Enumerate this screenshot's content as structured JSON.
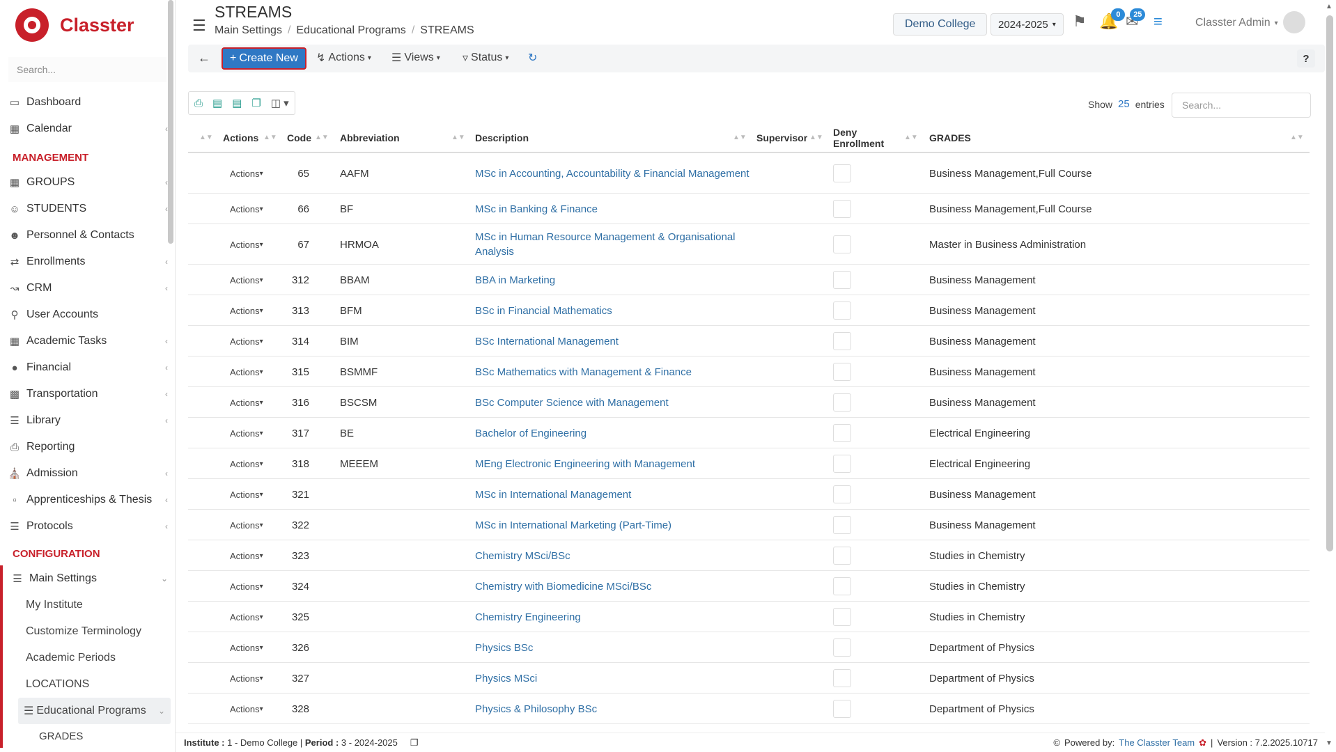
{
  "brand": "Classter",
  "sidebar": {
    "search_placeholder": "Search...",
    "top_items": [
      {
        "label": "Dashboard",
        "icon": "laptop-icon"
      },
      {
        "label": "Calendar",
        "icon": "calendar-icon"
      }
    ],
    "management_title": "MANAGEMENT",
    "management_items": [
      {
        "label": "GROUPS"
      },
      {
        "label": "STUDENTS"
      },
      {
        "label": "Personnel & Contacts"
      },
      {
        "label": "Enrollments"
      },
      {
        "label": "CRM"
      },
      {
        "label": "User Accounts"
      },
      {
        "label": "Academic Tasks"
      },
      {
        "label": "Financial"
      },
      {
        "label": "Transportation"
      },
      {
        "label": "Library"
      },
      {
        "label": "Reporting"
      },
      {
        "label": "Admission"
      },
      {
        "label": "Apprenticeships & Thesis"
      },
      {
        "label": "Protocols"
      }
    ],
    "configuration_title": "CONFIGURATION",
    "main_settings": "Main Settings",
    "sub_items": [
      "My Institute",
      "Customize Terminology",
      "Academic Periods",
      "LOCATIONS"
    ],
    "educational_programs": "Educational Programs",
    "grades": "GRADES"
  },
  "header": {
    "title": "STREAMS",
    "breadcrumb": [
      "Main Settings",
      "Educational Programs",
      "STREAMS"
    ],
    "college": "Demo College",
    "year": "2024-2025",
    "notifications_count": "0",
    "messages_count": "25",
    "user": "Classter Admin"
  },
  "toolbar": {
    "create_new": "Create New",
    "actions": "Actions",
    "views": "Views",
    "status": "Status",
    "help": "?"
  },
  "table_controls": {
    "show_label": "Show",
    "entries_count": "25",
    "entries_label": "entries",
    "search_placeholder": "Search..."
  },
  "table": {
    "columns": [
      "Actions",
      "Code",
      "Abbreviation",
      "Description",
      "Supervisor",
      "Deny Enrollment",
      "GRADES"
    ],
    "row_action_label": "Actions",
    "rows": [
      {
        "code": "65",
        "abbr": "AAFM",
        "desc": "MSc in Accounting, Accountability & Financial Management",
        "grades": "Business Management,Full Course"
      },
      {
        "code": "66",
        "abbr": "BF",
        "desc": "MSc in Banking & Finance",
        "grades": "Business Management,Full Course"
      },
      {
        "code": "67",
        "abbr": "HRMOA",
        "desc": "MSc in Human Resource Management & Organisational Analysis",
        "grades": "Master in Business Administration"
      },
      {
        "code": "312",
        "abbr": "BBAM",
        "desc": "BBA in Marketing",
        "grades": "Business Management"
      },
      {
        "code": "313",
        "abbr": "BFM",
        "desc": "BSc in Financial Mathematics",
        "grades": "Business Management"
      },
      {
        "code": "314",
        "abbr": "BIM",
        "desc": "BSc International Management",
        "grades": "Business Management"
      },
      {
        "code": "315",
        "abbr": "BSMMF",
        "desc": "BSc Mathematics with Management & Finance",
        "grades": "Business Management"
      },
      {
        "code": "316",
        "abbr": "BSCSM",
        "desc": "BSc Computer Science with Management",
        "grades": "Business Management"
      },
      {
        "code": "317",
        "abbr": "BE",
        "desc": "Bachelor of Engineering",
        "grades": "Electrical Engineering"
      },
      {
        "code": "318",
        "abbr": "MEEEM",
        "desc": "MEng Electronic Engineering with Management",
        "grades": "Electrical Engineering"
      },
      {
        "code": "321",
        "abbr": "",
        "desc": "MSc in International Management",
        "grades": "Business Management"
      },
      {
        "code": "322",
        "abbr": "",
        "desc": "MSc in International Marketing (Part-Time)",
        "grades": "Business Management"
      },
      {
        "code": "323",
        "abbr": "",
        "desc": "Chemistry MSci/BSc",
        "grades": "Studies in Chemistry"
      },
      {
        "code": "324",
        "abbr": "",
        "desc": "Chemistry with Biomedicine MSci/BSc",
        "grades": "Studies in Chemistry"
      },
      {
        "code": "325",
        "abbr": "",
        "desc": "Chemistry Engineering",
        "grades": "Studies in Chemistry"
      },
      {
        "code": "326",
        "abbr": "",
        "desc": "Physics BSc",
        "grades": "Department of Physics"
      },
      {
        "code": "327",
        "abbr": "",
        "desc": "Physics MSci",
        "grades": "Department of Physics"
      },
      {
        "code": "328",
        "abbr": "",
        "desc": "Physics & Philosophy BSc",
        "grades": "Department of Physics"
      }
    ]
  },
  "footer": {
    "institute_label": "Institute :",
    "institute_value": "1 - Demo College",
    "period_label": "Period :",
    "period_value": "3 - 2024-2025",
    "powered_by": "Powered by:",
    "team": "The Classter Team",
    "version": "Version : 7.2.2025.10717"
  }
}
